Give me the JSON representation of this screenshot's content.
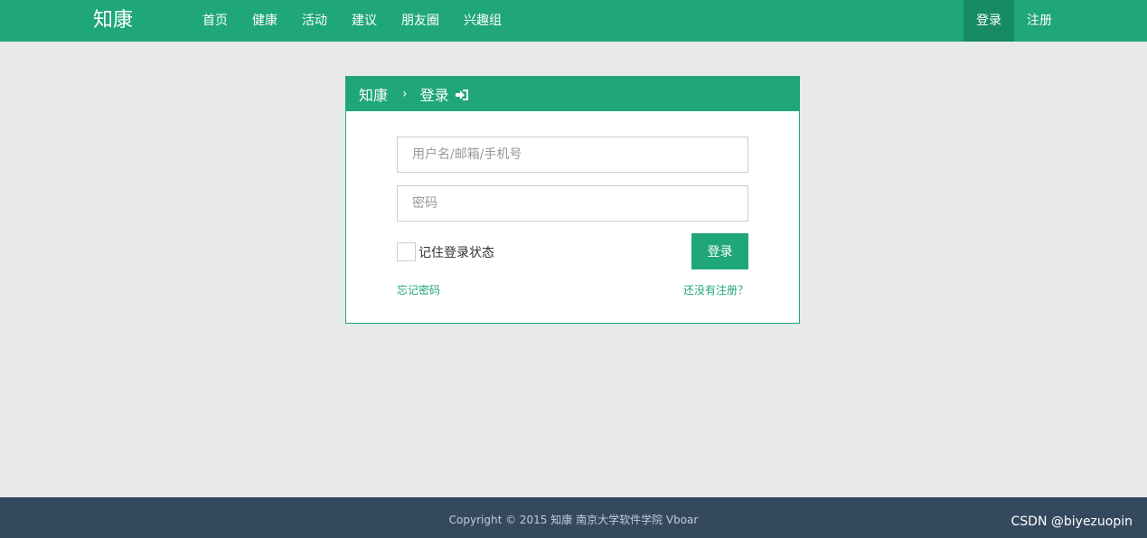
{
  "navbar": {
    "brand": "知康",
    "links": [
      "首页",
      "健康",
      "活动",
      "建议",
      "朋友圈",
      "兴趣组"
    ],
    "login": "登录",
    "register": "注册"
  },
  "panel": {
    "breadcrumb_home": "知康",
    "breadcrumb_sep": "›",
    "breadcrumb_current": "登录",
    "username_placeholder": "用户名/邮箱/手机号",
    "password_placeholder": "密码",
    "remember_label": "记住登录状态",
    "login_button": "登录",
    "forgot_link": "忘记密码",
    "register_link": "还没有注册？"
  },
  "footer": {
    "copyright": "Copyright © 2015 知康 南京大学软件学院 Vboar",
    "watermark": "CSDN @biyezuopin"
  },
  "colors": {
    "primary": "#1fa67a",
    "primary_dark": "#168a64",
    "background": "#e8e9eb",
    "footer": "#34495e"
  }
}
